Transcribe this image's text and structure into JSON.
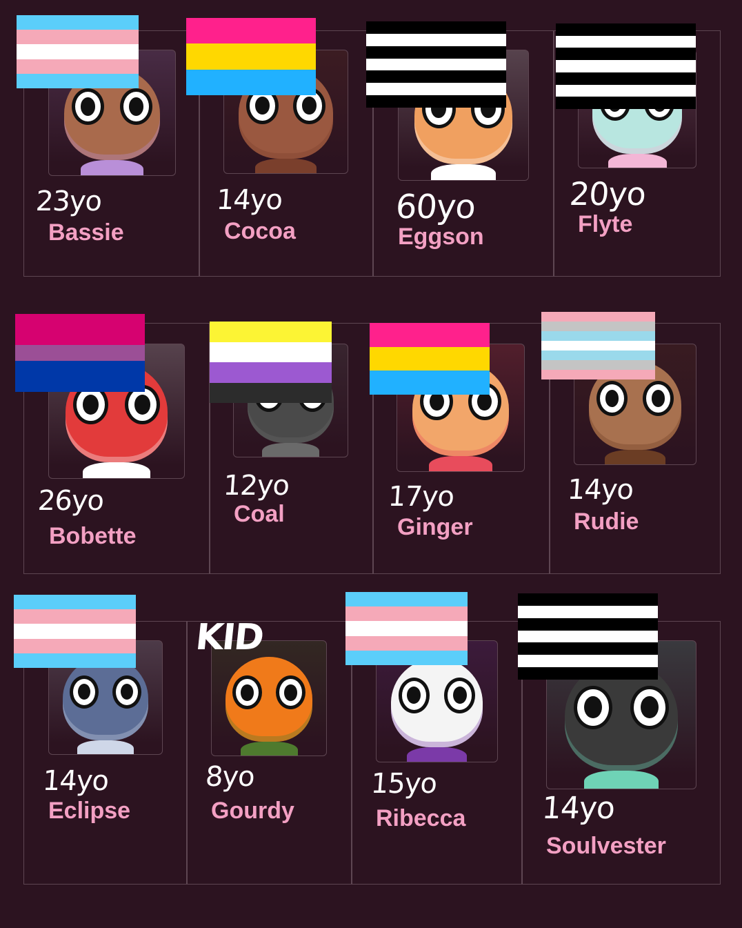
{
  "colors": {
    "background": "#2c1320",
    "grid_line": "#5e4652",
    "name_text": "#f3a0c3",
    "age_text": "#ffffff"
  },
  "flag_palettes": {
    "transgender": [
      "#5bcefa",
      "#f5a9b8",
      "#ffffff",
      "#f5a9b8",
      "#5bcefa"
    ],
    "pansexual": [
      "#ff218c",
      "#ffd800",
      "#21b1ff"
    ],
    "heterosexual": [
      "#000000",
      "#ffffff",
      "#000000",
      "#ffffff",
      "#000000",
      "#ffffff",
      "#000000"
    ],
    "bisexual": [
      "#d60270",
      "#d60270",
      "#9b4f96",
      "#0038a8",
      "#0038a8"
    ],
    "nonbinary": [
      "#fcf434",
      "#ffffff",
      "#9c59d1",
      "#2c2c2c"
    ],
    "demiboy": [
      "#f5a9b8",
      "#c4c4c4",
      "#9ad9eb",
      "#ffffff",
      "#9ad9eb",
      "#c4c4c4",
      "#f5a9b8"
    ]
  },
  "characters": [
    {
      "name": "Bassie",
      "age": "23yo",
      "flag": "transgender",
      "skin": "#a96a4c",
      "accent": "#b98fd8"
    },
    {
      "name": "Cocoa",
      "age": "14yo",
      "flag": "pansexual",
      "skin": "#9a5840",
      "accent": "#7a3f2c"
    },
    {
      "name": "Eggson",
      "age": "60yo",
      "flag": "heterosexual",
      "skin": "#f0a060",
      "accent": "#ffffff"
    },
    {
      "name": "Flyte",
      "age": "20yo",
      "flag": "heterosexual",
      "skin": "#b8e6e0",
      "accent": "#f3b6d6"
    },
    {
      "name": "Bobette",
      "age": "26yo",
      "flag": "bisexual",
      "skin": "#e23b3b",
      "accent": "#ffffff"
    },
    {
      "name": "Coal",
      "age": "12yo",
      "flag": "nonbinary",
      "skin": "#4a4a4a",
      "accent": "#6a6a6a"
    },
    {
      "name": "Ginger",
      "age": "17yo",
      "flag": "pansexual",
      "skin": "#f2a66a",
      "accent": "#e84c5c"
    },
    {
      "name": "Rudie",
      "age": "14yo",
      "flag": "demiboy",
      "skin": "#a8714f",
      "accent": "#6b3d24"
    },
    {
      "name": "Eclipse",
      "age": "14yo",
      "flag": "transgender",
      "skin": "#5c6d96",
      "accent": "#cfd7e8"
    },
    {
      "name": "Gourdy",
      "age": "8yo",
      "flag": "none",
      "note": "KID",
      "skin": "#f07a1a",
      "accent": "#4e7a2e"
    },
    {
      "name": "Ribecca",
      "age": "15yo",
      "flag": "transgender",
      "skin": "#f4f4f4",
      "accent": "#7b3aa8"
    },
    {
      "name": "Soulvester",
      "age": "14yo",
      "flag": "heterosexual",
      "skin": "#3a3a3a",
      "accent": "#6fd3b6"
    }
  ]
}
